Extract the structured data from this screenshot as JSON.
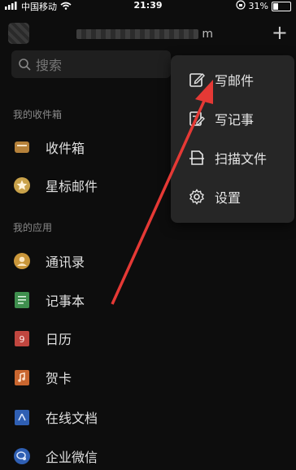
{
  "status_bar": {
    "carrier": "中国移动",
    "time": "21:39",
    "battery": "31%",
    "battery_level": 0.31
  },
  "header": {
    "account_suffix": "m"
  },
  "search": {
    "placeholder": "搜索"
  },
  "sections": {
    "inbox_title": "我的收件箱",
    "apps_title": "我的应用"
  },
  "inbox_items": [
    "收件箱",
    "星标邮件"
  ],
  "apps_items": [
    "通讯录",
    "记事本",
    "日历",
    "贺卡",
    "在线文档",
    "企业微信"
  ],
  "calendar_badge": "9",
  "menu": {
    "items": [
      "写邮件",
      "写记事",
      "扫描文件",
      "设置"
    ]
  },
  "colors": {
    "accent_arrow": "#e53935",
    "inbox_icon": "#b5813a",
    "star_icon": "#c9a24a",
    "contacts_icon": "#c9963a",
    "notes_icon": "#3f8f4e",
    "calendar_icon": "#c0463f",
    "card_icon": "#c9662f",
    "docs_icon": "#2f5fb3",
    "wework_icon": "#2f5fb3"
  }
}
